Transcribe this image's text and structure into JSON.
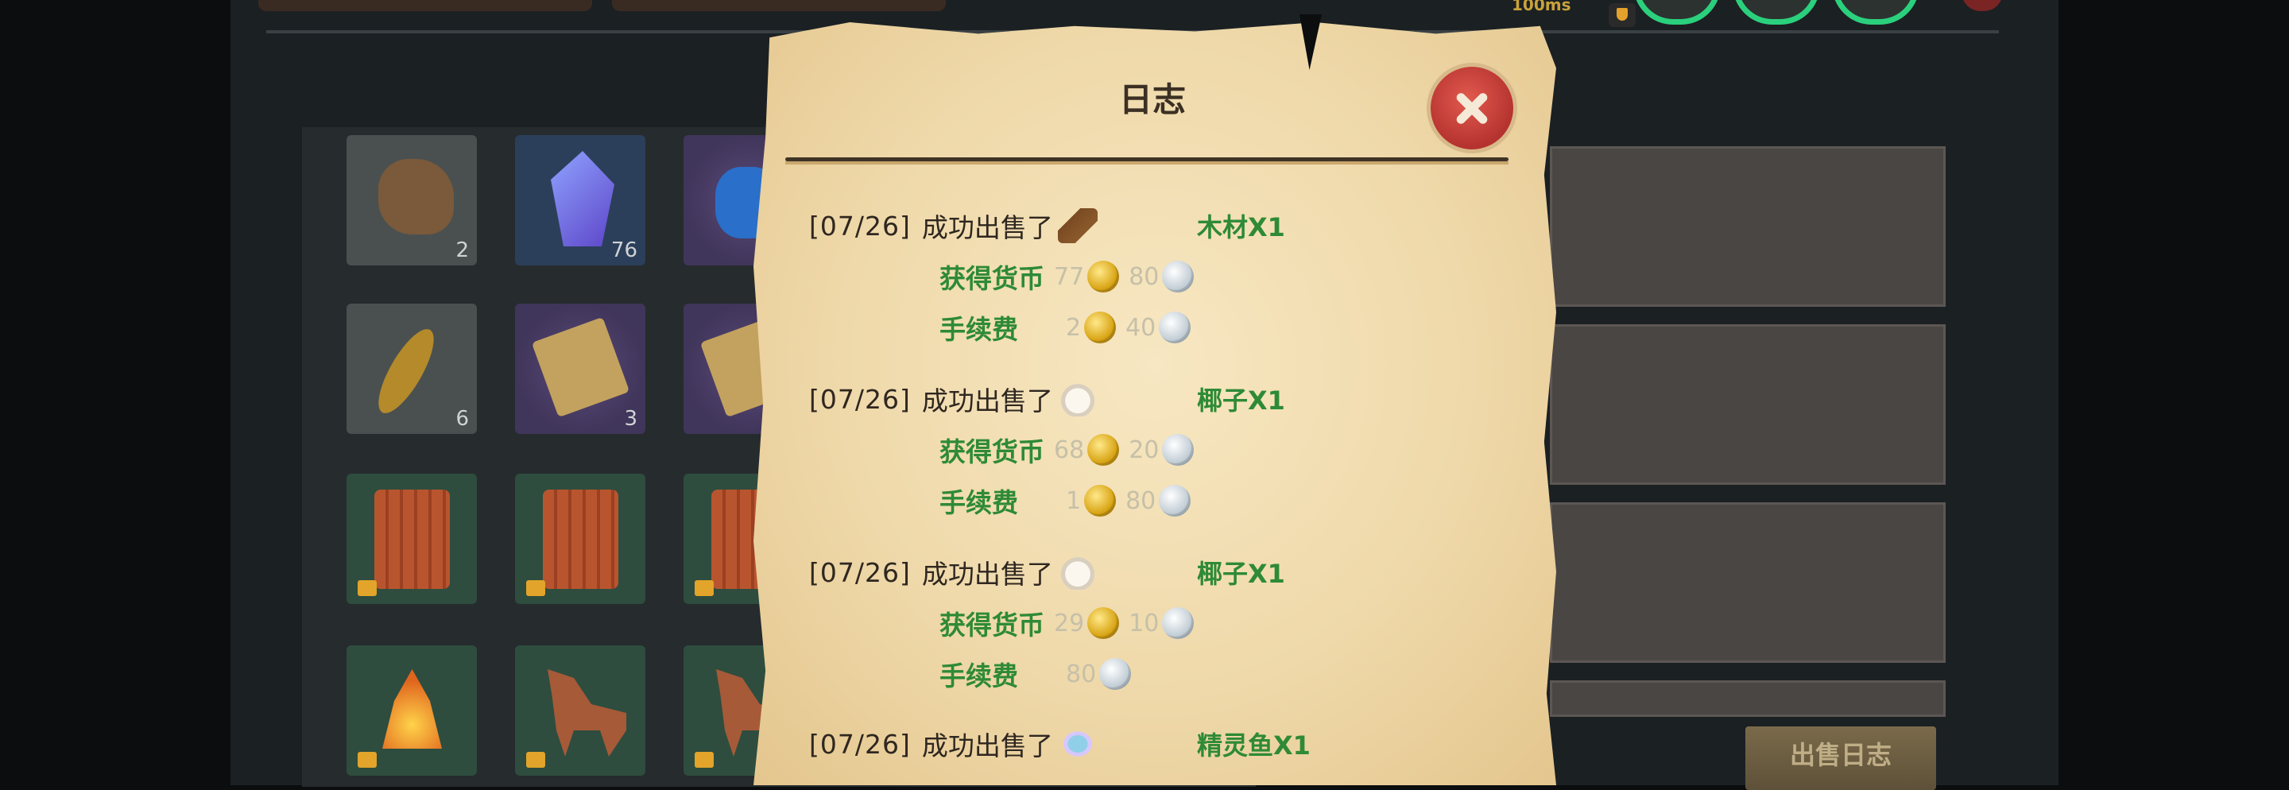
{
  "header": {
    "ping": "100ms"
  },
  "inventory": {
    "slots": [
      {
        "icon": "ore-icon",
        "count": "2"
      },
      {
        "icon": "crystal-icon",
        "count": "76"
      },
      {
        "icon": "potion-icon",
        "count": ""
      },
      {
        "icon": "feather-icon",
        "count": "6"
      },
      {
        "icon": "scroll-icon",
        "count": "3"
      },
      {
        "icon": "scroll-icon",
        "count": ""
      },
      {
        "icon": "chest-icon",
        "count": ""
      },
      {
        "icon": "chest-icon",
        "count": ""
      },
      {
        "icon": "chest-icon",
        "count": ""
      },
      {
        "icon": "campfire-icon",
        "count": ""
      },
      {
        "icon": "horse-icon",
        "count": ""
      },
      {
        "icon": "horse-icon",
        "count": ""
      }
    ]
  },
  "sell_log_button": "出售日志",
  "dialog": {
    "title": "日志",
    "close_icon": "close-icon",
    "entries": [
      {
        "date": "[07/26]",
        "action": "成功出售了",
        "item_icon": "wood-icon",
        "item": "木材X1",
        "gain_label": "获得货币",
        "gain_gold": "77",
        "gain_silver": "80",
        "fee_label": "手续费",
        "fee_gold": "2",
        "fee_silver": "40"
      },
      {
        "date": "[07/26]",
        "action": "成功出售了",
        "item_icon": "coconut-icon",
        "item": "椰子X1",
        "gain_label": "获得货币",
        "gain_gold": "68",
        "gain_silver": "20",
        "fee_label": "手续费",
        "fee_gold": "1",
        "fee_silver": "80"
      },
      {
        "date": "[07/26]",
        "action": "成功出售了",
        "item_icon": "coconut-icon",
        "item": "椰子X1",
        "gain_label": "获得货币",
        "gain_gold": "29",
        "gain_silver": "10",
        "fee_label": "手续费",
        "fee_gold": "",
        "fee_silver": "80"
      },
      {
        "date": "[07/26]",
        "action": "成功出售了",
        "item_icon": "fish-icon",
        "item": "精灵鱼X1"
      }
    ]
  }
}
